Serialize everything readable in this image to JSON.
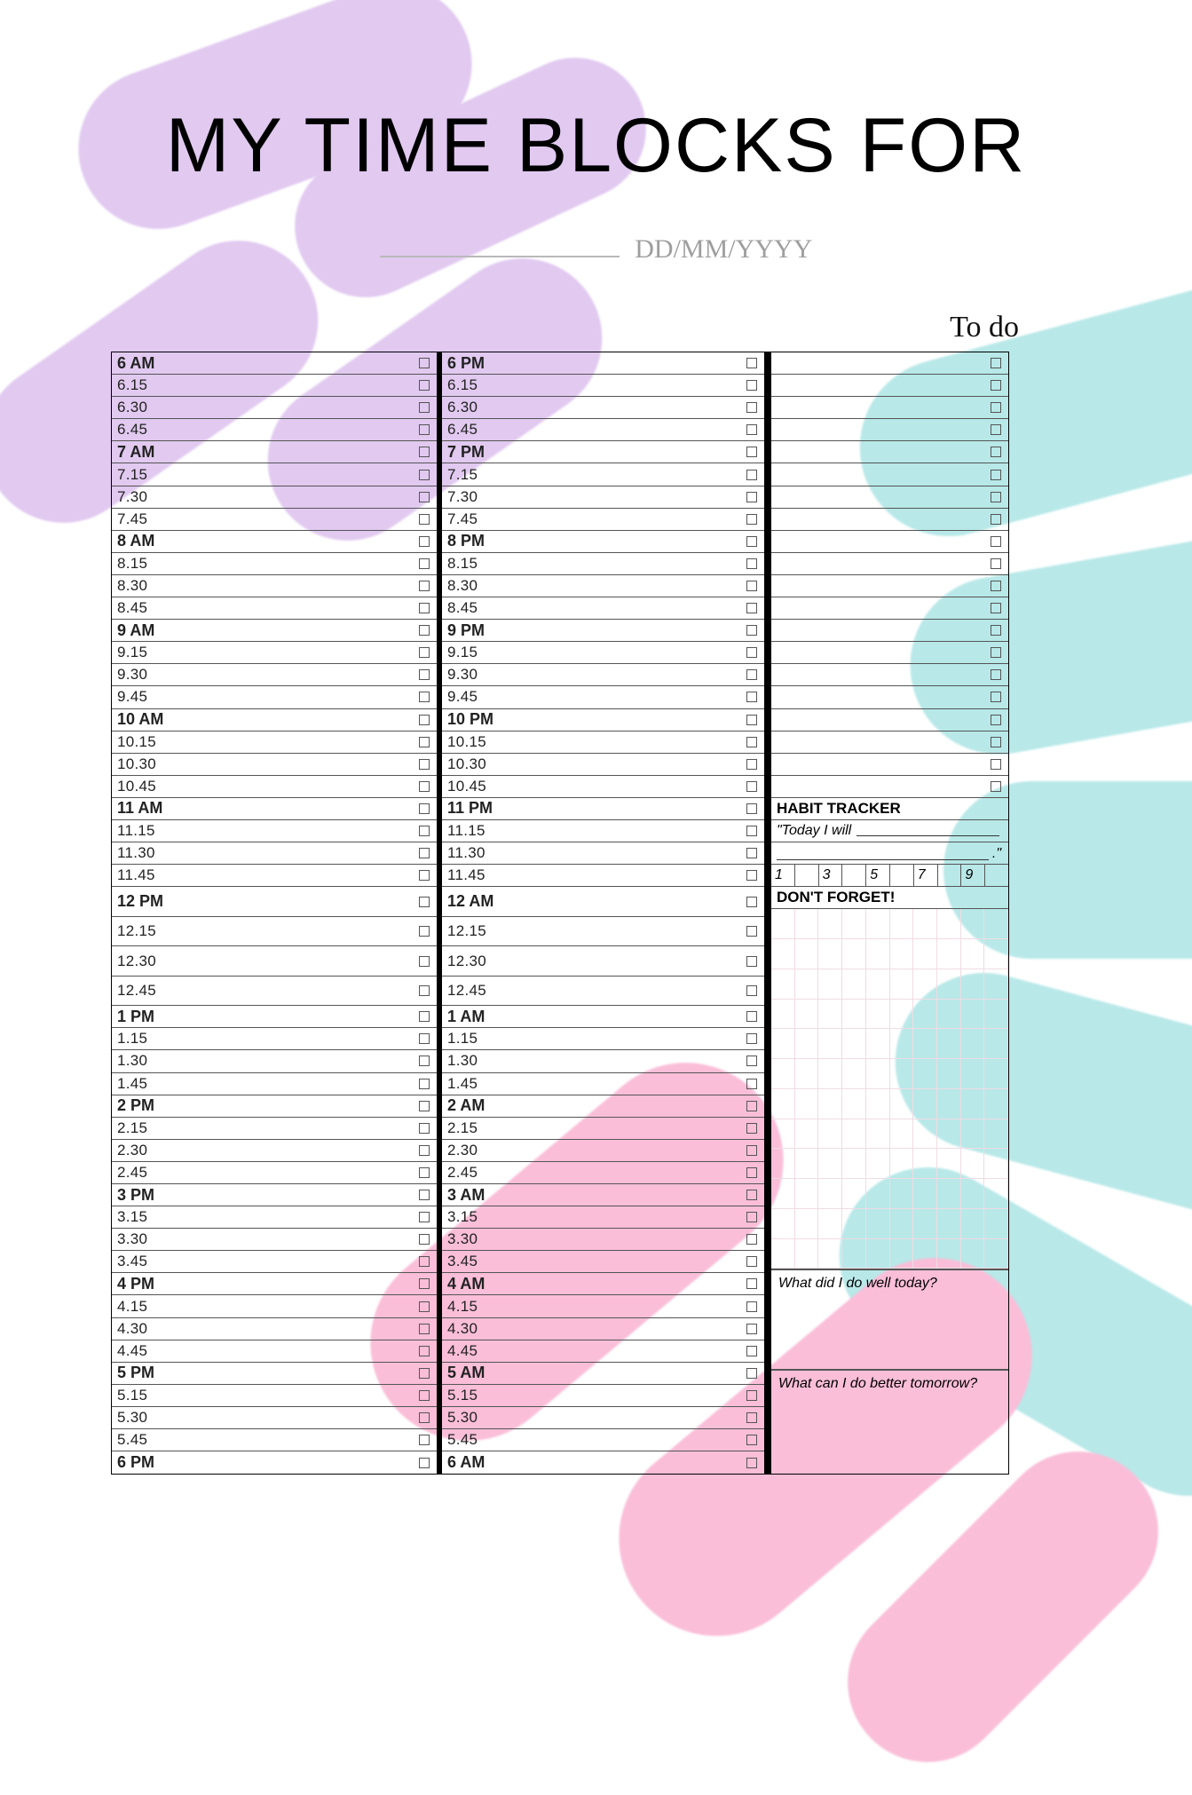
{
  "title": "MY TIME BLOCKS FOR",
  "date_placeholder": "DD/MM/YYYY",
  "todo_heading": "To do",
  "habit_tracker_heading": "HABIT TRACKER",
  "habit_quote": "\"Today I will",
  "habit_quote_end": ".\"",
  "habit_numbers": [
    "1",
    "",
    "3",
    "",
    "5",
    "",
    "7",
    "",
    "9",
    ""
  ],
  "dont_forget_heading": "DON'T FORGET!",
  "reflect_well": "What did I do well today?",
  "reflect_better": "What can I do better tomorrow?",
  "left_col": [
    {
      "t": "6 AM",
      "h": true
    },
    {
      "t": "6.15"
    },
    {
      "t": "6.30"
    },
    {
      "t": "6.45"
    },
    {
      "t": "7 AM",
      "h": true
    },
    {
      "t": "7.15"
    },
    {
      "t": "7.30"
    },
    {
      "t": "7.45"
    },
    {
      "t": "8 AM",
      "h": true
    },
    {
      "t": "8.15"
    },
    {
      "t": "8.30"
    },
    {
      "t": "8.45"
    },
    {
      "t": "9 AM",
      "h": true
    },
    {
      "t": "9.15"
    },
    {
      "t": "9.30"
    },
    {
      "t": "9.45"
    },
    {
      "t": "10 AM",
      "h": true
    },
    {
      "t": "10.15"
    },
    {
      "t": "10.30"
    },
    {
      "t": "10.45"
    },
    {
      "t": "11 AM",
      "h": true
    },
    {
      "t": "11.15"
    },
    {
      "t": "11.30"
    },
    {
      "t": "11.45"
    },
    {
      "t": "12 PM",
      "h": true,
      "tall": true
    },
    {
      "t": "12.15",
      "tall": true
    },
    {
      "t": "12.30",
      "tall": true
    },
    {
      "t": "12.45",
      "tall": true
    },
    {
      "t": "1 PM",
      "h": true
    },
    {
      "t": "1.15"
    },
    {
      "t": "1.30"
    },
    {
      "t": "1.45"
    },
    {
      "t": "2 PM",
      "h": true
    },
    {
      "t": "2.15"
    },
    {
      "t": "2.30"
    },
    {
      "t": "2.45"
    },
    {
      "t": "3 PM",
      "h": true
    },
    {
      "t": "3.15"
    },
    {
      "t": "3.30"
    },
    {
      "t": "3.45"
    },
    {
      "t": "4 PM",
      "h": true
    },
    {
      "t": "4.15"
    },
    {
      "t": "4.30"
    },
    {
      "t": "4.45"
    },
    {
      "t": "5 PM",
      "h": true
    },
    {
      "t": "5.15"
    },
    {
      "t": "5.30"
    },
    {
      "t": "5.45"
    },
    {
      "t": "6 PM",
      "h": true
    }
  ],
  "mid_col": [
    {
      "t": "6 PM",
      "h": true
    },
    {
      "t": "6.15"
    },
    {
      "t": "6.30"
    },
    {
      "t": "6.45"
    },
    {
      "t": "7 PM",
      "h": true
    },
    {
      "t": "7.15"
    },
    {
      "t": "7.30"
    },
    {
      "t": "7.45"
    },
    {
      "t": "8 PM",
      "h": true
    },
    {
      "t": "8.15"
    },
    {
      "t": "8.30"
    },
    {
      "t": "8.45"
    },
    {
      "t": "9 PM",
      "h": true
    },
    {
      "t": "9.15"
    },
    {
      "t": "9.30"
    },
    {
      "t": "9.45"
    },
    {
      "t": "10 PM",
      "h": true
    },
    {
      "t": "10.15"
    },
    {
      "t": "10.30"
    },
    {
      "t": "10.45"
    },
    {
      "t": "11 PM",
      "h": true
    },
    {
      "t": "11.15"
    },
    {
      "t": "11.30"
    },
    {
      "t": "11.45"
    },
    {
      "t": "12 AM",
      "h": true,
      "tall": true
    },
    {
      "t": "12.15",
      "tall": true
    },
    {
      "t": "12.30",
      "tall": true
    },
    {
      "t": "12.45",
      "tall": true
    },
    {
      "t": "1 AM",
      "h": true
    },
    {
      "t": "1.15"
    },
    {
      "t": "1.30"
    },
    {
      "t": "1.45"
    },
    {
      "t": "2 AM",
      "h": true
    },
    {
      "t": "2.15"
    },
    {
      "t": "2.30"
    },
    {
      "t": "2.45"
    },
    {
      "t": "3 AM",
      "h": true
    },
    {
      "t": "3.15"
    },
    {
      "t": "3.30"
    },
    {
      "t": "3.45"
    },
    {
      "t": "4 AM",
      "h": true
    },
    {
      "t": "4.15"
    },
    {
      "t": "4.30"
    },
    {
      "t": "4.45"
    },
    {
      "t": "5 AM",
      "h": true
    },
    {
      "t": "5.15"
    },
    {
      "t": "5.30"
    },
    {
      "t": "5.45"
    },
    {
      "t": "6 AM",
      "h": true
    }
  ],
  "todo_rows": 20
}
